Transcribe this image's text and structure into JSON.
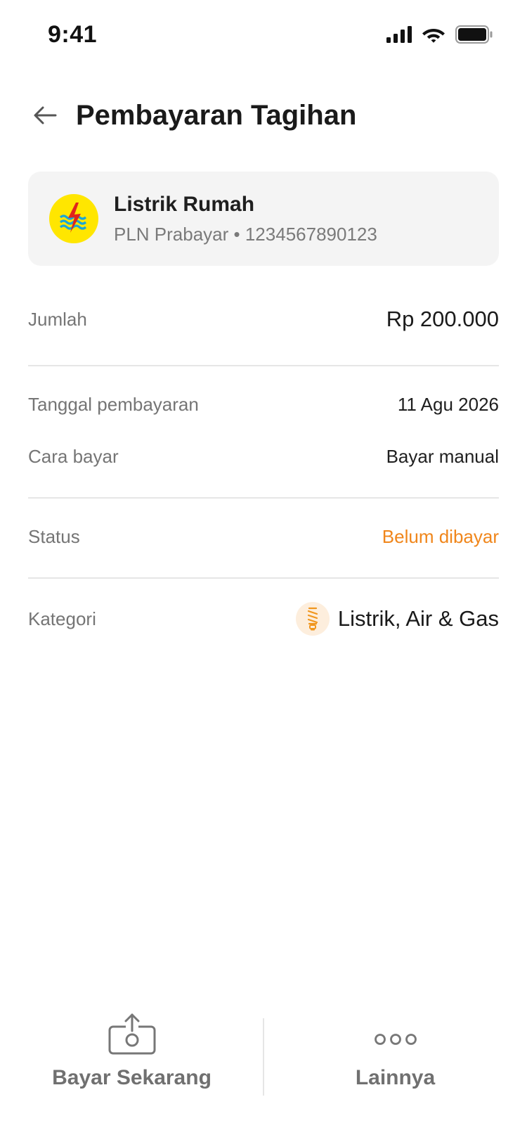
{
  "status_bar": {
    "time": "9:41",
    "icons": [
      "signal-icon",
      "wifi-icon",
      "battery-icon"
    ]
  },
  "header": {
    "back_icon": "arrow-left-icon",
    "title": "Pembayaran Tagihan"
  },
  "biller": {
    "logo_icon": "pln-logo-icon",
    "name": "Listrik Rumah",
    "subtitle": "PLN Prabayar • 1234567890123"
  },
  "details": {
    "amount": {
      "label": "Jumlah",
      "value": "Rp 200.000"
    },
    "payment_date": {
      "label": "Tanggal pembayaran",
      "value": "11 Agu 2026"
    },
    "payment_method": {
      "label": "Cara bayar",
      "value": "Bayar manual"
    },
    "status": {
      "label": "Status",
      "value": "Belum dibayar",
      "color": "#f0861b"
    },
    "category": {
      "label": "Kategori",
      "value": "Listrik, Air & Gas",
      "icon": "lightbulb-icon"
    }
  },
  "actions": {
    "pay_now": {
      "label": "Bayar Sekarang",
      "icon": "upload-money-icon"
    },
    "more": {
      "label": "Lainnya",
      "icon": "more-dots-icon"
    }
  },
  "colors": {
    "accent_orange": "#f0861b",
    "card_bg": "#f4f4f4",
    "pln_yellow": "#ffe600"
  }
}
